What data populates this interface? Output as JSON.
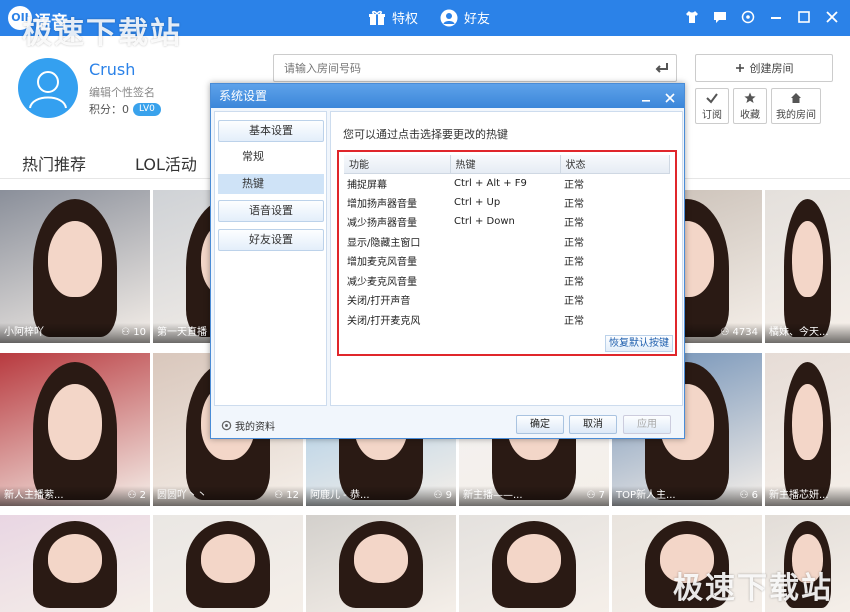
{
  "app": {
    "logo_text": "OII",
    "name": "语音"
  },
  "watermark": "极速下载站",
  "top_nav": [
    {
      "label": "特权",
      "icon": "gift-icon"
    },
    {
      "label": "好友",
      "icon": "user-friend-icon"
    }
  ],
  "window_controls": [
    "shirt-icon",
    "chat-bubble-icon",
    "settings-circle-icon",
    "minimize-icon",
    "maximize-icon",
    "close-icon"
  ],
  "profile": {
    "username": "Crush",
    "signature": "编辑个性签名",
    "points_label": "积分：0",
    "level": "LV0",
    "search_placeholder": "请输入房间号码",
    "create_room_label": "创建房间",
    "actions": [
      {
        "label": "订阅",
        "icon": "check-icon"
      },
      {
        "label": "收藏",
        "icon": "star-icon"
      },
      {
        "label": "我的房间",
        "icon": "home-icon"
      }
    ]
  },
  "tabs": [
    "热门推荐",
    "LOL活动"
  ],
  "tiles": [
    {
      "name": "小阿梓吖",
      "count": "10"
    },
    {
      "name": "第一天直播",
      "count": ""
    },
    {
      "name": "",
      "count": ""
    },
    {
      "name": "",
      "count": ""
    },
    {
      "name": "",
      "count": "4734"
    },
    {
      "name": "橘妹、今天...",
      "count": ""
    },
    {
      "name": "新人主播萦...",
      "count": "2"
    },
    {
      "name": "圆圆吖丶丶",
      "count": "12"
    },
    {
      "name": "阿鹿儿 - 恭...",
      "count": "9"
    },
    {
      "name": "新主播——...",
      "count": "7"
    },
    {
      "name": "TOP新人主...",
      "count": "6"
    },
    {
      "name": "新主播芯妍...",
      "count": ""
    },
    {
      "name": "",
      "count": ""
    },
    {
      "name": "",
      "count": ""
    },
    {
      "name": "",
      "count": ""
    },
    {
      "name": "",
      "count": ""
    },
    {
      "name": "",
      "count": ""
    },
    {
      "name": "",
      "count": ""
    }
  ],
  "dialog": {
    "title": "系统设置",
    "sidebar": {
      "basic": "基本设置",
      "sub_items": [
        "常规",
        "热键"
      ],
      "active_sub": "热键",
      "voice": "语音设置",
      "friends": "好友设置"
    },
    "hint": "您可以通过点击选择要更改的热键",
    "table": {
      "headers": [
        "功能",
        "热键",
        "状态"
      ],
      "rows": [
        {
          "function": "捕捉屏幕",
          "hotkey": "Ctrl + Alt + F9",
          "status": "正常"
        },
        {
          "function": "增加扬声器音量",
          "hotkey": "Ctrl + Up",
          "status": "正常"
        },
        {
          "function": "减少扬声器音量",
          "hotkey": "Ctrl + Down",
          "status": "正常"
        },
        {
          "function": "显示/隐藏主窗口",
          "hotkey": "",
          "status": "正常"
        },
        {
          "function": "增加麦克风音量",
          "hotkey": "",
          "status": "正常"
        },
        {
          "function": "减少麦克风音量",
          "hotkey": "",
          "status": "正常"
        },
        {
          "function": "关闭/打开声音",
          "hotkey": "",
          "status": "正常"
        },
        {
          "function": "关闭/打开麦克风",
          "hotkey": "",
          "status": "正常"
        }
      ]
    },
    "restore_label": "恢复默认按键",
    "my_info_label": "我的资料",
    "ok_label": "确定",
    "cancel_label": "取消",
    "apply_label": "应用"
  },
  "colors": {
    "accent": "#2b82e8",
    "highlight_border": "#e0262b"
  }
}
